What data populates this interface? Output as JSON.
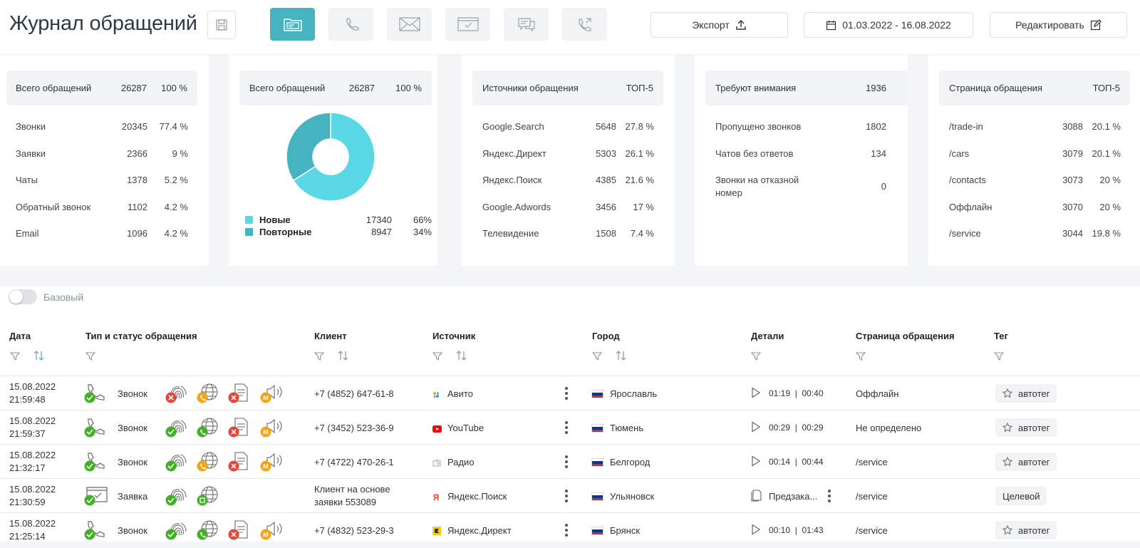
{
  "header": {
    "title": "Журнал обращений",
    "export_label": "Экспорт",
    "date_range": "01.03.2022 - 16.08.2022",
    "edit_label": "Редактировать"
  },
  "cards": {
    "total": {
      "title": "Всего обращений",
      "count": "26287",
      "pct": "100 %",
      "rows": [
        {
          "label": "Звонки",
          "count": "20345",
          "pct": "77.4 %"
        },
        {
          "label": "Заявки",
          "count": "2366",
          "pct": "9 %"
        },
        {
          "label": "Чаты",
          "count": "1378",
          "pct": "5.2 %"
        },
        {
          "label": "Обратный звонок",
          "count": "1102",
          "pct": "4.2 %"
        },
        {
          "label": "Email",
          "count": "1096",
          "pct": "4.2 %"
        }
      ]
    },
    "donut": {
      "title": "Всего обращений",
      "count": "26287",
      "pct": "100 %",
      "legend": [
        {
          "label": "Новые",
          "count": "17340",
          "pct": "66%",
          "color": "#5ad8e6",
          "value": 66
        },
        {
          "label": "Повторные",
          "count": "8947",
          "pct": "34%",
          "color": "#45b3c0",
          "value": 34
        }
      ]
    },
    "sources": {
      "title": "Источники обращения",
      "badge": "ТОП-5",
      "rows": [
        {
          "label": "Google.Search",
          "count": "5648",
          "pct": "27.8 %"
        },
        {
          "label": "Яндекс.Директ",
          "count": "5303",
          "pct": "26.1 %"
        },
        {
          "label": "Яндекс.Поиск",
          "count": "4385",
          "pct": "21.6 %"
        },
        {
          "label": "Google.Adwords",
          "count": "3456",
          "pct": "17 %"
        },
        {
          "label": "Телевидение",
          "count": "1508",
          "pct": "7.4 %"
        }
      ]
    },
    "attention": {
      "title": "Требуют внимания",
      "count": "1936",
      "rows": [
        {
          "label": "Пропущено звонков",
          "count": "1802"
        },
        {
          "label": "Чатов без ответов",
          "count": "134"
        },
        {
          "label1": "Звонки на отказной",
          "label2": "номер",
          "count": "0"
        }
      ]
    },
    "pages": {
      "title": "Страница обращения",
      "badge": "ТОП-5",
      "rows": [
        {
          "label": "/trade-in",
          "count": "3088",
          "pct": "20.1 %"
        },
        {
          "label": "/cars",
          "count": "3079",
          "pct": "20.1 %"
        },
        {
          "label": "/contacts",
          "count": "3073",
          "pct": "20 %"
        },
        {
          "label": "Оффлайн",
          "count": "3070",
          "pct": "20 %"
        },
        {
          "label": "/service",
          "count": "3044",
          "pct": "19.8 %"
        }
      ]
    }
  },
  "toggle": {
    "label": "Базовый"
  },
  "table": {
    "columns": {
      "date": "Дата",
      "type": "Тип и статус обращения",
      "client": "Клиент",
      "source": "Источник",
      "city": "Город",
      "details": "Детали",
      "page": "Страница обращения",
      "tag": "Тег"
    },
    "rows": [
      {
        "date": "15.08.2022",
        "time": "21:59:48",
        "type": "Звонок",
        "client": "+7 (4852) 647-61-8",
        "source": "Авито",
        "city": "Ярославль",
        "dur1": "01:19",
        "dur2": "00:40",
        "page": "Оффлайн",
        "tag": "автотег"
      },
      {
        "date": "15.08.2022",
        "time": "21:59:37",
        "type": "Звонок",
        "client": "+7 (3452) 523-36-9",
        "source": "YouTube",
        "city": "Тюмень",
        "dur1": "00:29",
        "dur2": "00:29",
        "page": "Не определено",
        "tag": "автотег"
      },
      {
        "date": "15.08.2022",
        "time": "21:32:17",
        "type": "Звонок",
        "client": "+7 (4722) 470-26-1",
        "source": "Радио",
        "city": "Белгород",
        "dur1": "00:14",
        "dur2": "00:44",
        "page": "/service",
        "tag": "автотег"
      },
      {
        "date": "15.08.2022",
        "time": "21:30:59",
        "type": "Заявка",
        "client1": "Клиент на основе",
        "client2": "заявки 553089",
        "source": "Яндекс.Поиск",
        "city": "Ульяновск",
        "details": "Предзака...",
        "page": "/service",
        "tag": "Целевой"
      },
      {
        "date": "15.08.2022",
        "time": "21:25:14",
        "type": "Звонок",
        "client": "+7 (4832) 523-29-3",
        "source": "Яндекс.Директ",
        "city": "Брянск",
        "dur1": "00:10",
        "dur2": "01:43",
        "page": "/service",
        "tag": "автотег"
      }
    ]
  },
  "colors": {
    "accent": "#45b3c0",
    "ok": "#43b02a",
    "error": "#e6453a",
    "warn": "#f2a414"
  }
}
